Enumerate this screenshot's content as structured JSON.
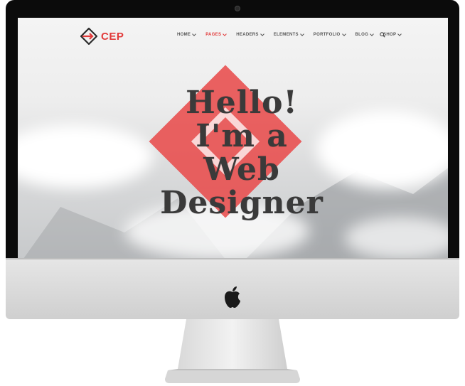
{
  "brand": {
    "name": "CEP",
    "accent": "#e23b3b"
  },
  "nav": {
    "items": [
      {
        "label": "HOME",
        "active": false
      },
      {
        "label": "PAGES",
        "active": true
      },
      {
        "label": "HEADERS",
        "active": false
      },
      {
        "label": "ELEMENTS",
        "active": false
      },
      {
        "label": "PORTFOLIO",
        "active": false
      },
      {
        "label": "BLOG",
        "active": false
      },
      {
        "label": "SHOP",
        "active": false
      }
    ],
    "search_icon": "search-icon"
  },
  "hero": {
    "lines": [
      "Hello!",
      "I'm a",
      "Web",
      "Designer"
    ]
  },
  "device": {
    "logo_icon": "apple-logo-icon"
  }
}
